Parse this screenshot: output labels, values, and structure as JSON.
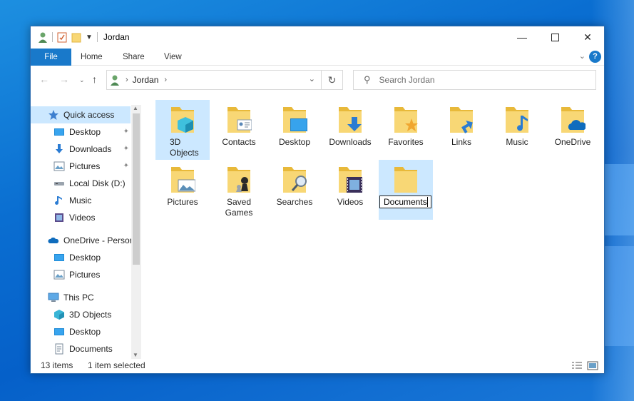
{
  "window": {
    "title": "Jordan"
  },
  "ribbon": {
    "file": "File",
    "home": "Home",
    "share": "Share",
    "view": "View",
    "help": "?"
  },
  "address": {
    "crumb": "Jordan",
    "search_placeholder": "Search Jordan"
  },
  "nav": {
    "items": [
      {
        "label": "Quick access",
        "icon": "star-icon",
        "pinned": false
      },
      {
        "label": "Desktop",
        "icon": "desktop-icon",
        "pinned": true
      },
      {
        "label": "Downloads",
        "icon": "download-icon",
        "pinned": true
      },
      {
        "label": "Pictures",
        "icon": "pictures-icon",
        "pinned": true
      },
      {
        "label": "Local Disk (D:)",
        "icon": "drive-icon",
        "pinned": false
      },
      {
        "label": "Music",
        "icon": "music-icon",
        "pinned": false
      },
      {
        "label": "Videos",
        "icon": "videos-icon",
        "pinned": false
      },
      {
        "label": "OneDrive - Persor",
        "icon": "cloud-icon",
        "pinned": false
      },
      {
        "label": "Desktop",
        "icon": "desktop-icon",
        "pinned": false
      },
      {
        "label": "Pictures",
        "icon": "pictures-icon",
        "pinned": false
      },
      {
        "label": "This PC",
        "icon": "pc-icon",
        "pinned": false
      },
      {
        "label": "3D Objects",
        "icon": "cube-icon",
        "pinned": false
      },
      {
        "label": "Desktop",
        "icon": "desktop-icon",
        "pinned": false
      },
      {
        "label": "Documents",
        "icon": "documents-icon",
        "pinned": false
      }
    ]
  },
  "folders": [
    {
      "label": "3D Objects",
      "icon": "cube-icon"
    },
    {
      "label": "Contacts",
      "icon": "contact-card-icon"
    },
    {
      "label": "Desktop",
      "icon": "desktop-icon"
    },
    {
      "label": "Downloads",
      "icon": "download-arrow-icon"
    },
    {
      "label": "Favorites",
      "icon": "star-icon"
    },
    {
      "label": "Links",
      "icon": "link-arrow-icon"
    },
    {
      "label": "Music",
      "icon": "music-note-icon"
    },
    {
      "label": "OneDrive",
      "icon": "cloud-icon"
    },
    {
      "label": "Pictures",
      "icon": "landscape-icon"
    },
    {
      "label": "Saved Games",
      "icon": "chess-piece-icon"
    },
    {
      "label": "Searches",
      "icon": "magnifier-icon"
    },
    {
      "label": "Videos",
      "icon": "film-icon"
    },
    {
      "label": "Documents",
      "icon": "folder-icon"
    }
  ],
  "status": {
    "count": "13 items",
    "selection": "1 item selected"
  },
  "colors": {
    "accent": "#1979ca",
    "selection": "#cce8ff",
    "folder": "#f8d775",
    "folder_dark": "#e8b93a"
  }
}
